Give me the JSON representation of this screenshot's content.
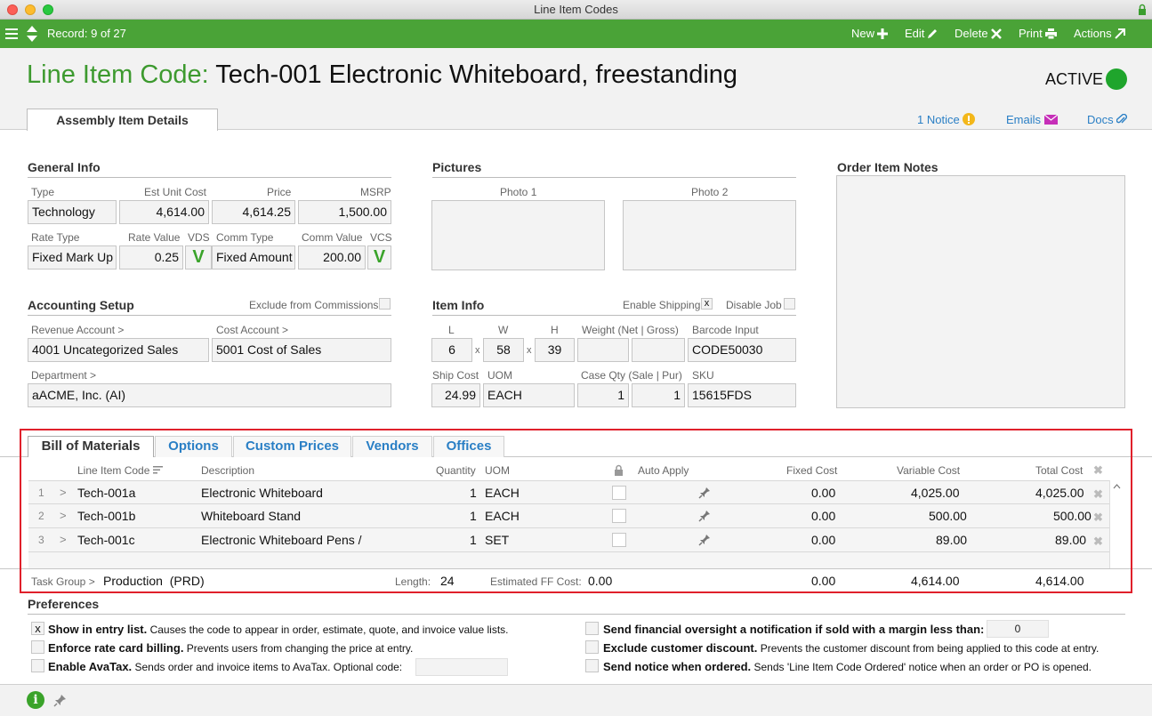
{
  "window": {
    "title": "Line Item Codes"
  },
  "toolbar": {
    "record": "Record: 9 of 27",
    "new_label": "New",
    "edit_label": "Edit",
    "delete_label": "Delete",
    "print_label": "Print",
    "actions_label": "Actions"
  },
  "header": {
    "title_label": "Line Item Code:",
    "title_value": "Tech-001 Electronic Whiteboard, freestanding",
    "status": "ACTIVE",
    "tab": "Assembly Item Details",
    "notice": "1 Notice",
    "emails": "Emails",
    "docs": "Docs",
    "colors": {
      "brand_green": "#4aa337",
      "status_green": "#1fa52c",
      "link_blue": "#2a7fc5",
      "highlight_red": "#e0202b"
    }
  },
  "general": {
    "heading": "General Info",
    "type_label": "Type",
    "type": "Technology",
    "est_unit_cost_label": "Est Unit Cost",
    "est_unit_cost": "4,614.00",
    "price_label": "Price",
    "price": "4,614.25",
    "msrp_label": "MSRP",
    "msrp": "1,500.00",
    "rate_type_label": "Rate Type",
    "rate_type": "Fixed Mark Up",
    "rate_value_label": "Rate Value",
    "rate_value": "0.25",
    "vds_label": "VDS",
    "vds": "V",
    "comm_type_label": "Comm Type",
    "comm_type": "Fixed Amount",
    "comm_value_label": "Comm Value",
    "comm_value": "200.00",
    "vcs_label": "VCS",
    "vcs": "V"
  },
  "pictures": {
    "heading": "Pictures",
    "photo1": "Photo 1",
    "photo2": "Photo 2"
  },
  "notes": {
    "heading": "Order Item Notes"
  },
  "accounting": {
    "heading": "Accounting Setup",
    "exclude_label": "Exclude from Commissions",
    "revenue_label": "Revenue Account >",
    "revenue": "4001 Uncategorized Sales",
    "cost_label": "Cost Account >",
    "cost": "5001 Cost of Sales",
    "department_label": "Department >",
    "department": "aACME, Inc. (AI)"
  },
  "item_info": {
    "heading": "Item Info",
    "enable_shipping_label": "Enable Shipping",
    "enable_shipping_mark": "x",
    "disable_job_label": "Disable Job",
    "l_label": "L",
    "l": "6",
    "w_label": "W",
    "w": "58",
    "h_label": "H",
    "h": "39",
    "x_sep": "x",
    "weight_label": "Weight (Net | Gross)",
    "barcode_label": "Barcode Input",
    "barcode": "CODE50030",
    "ship_cost_label": "Ship Cost",
    "ship_cost": "24.99",
    "uom_label": "UOM",
    "uom": "EACH",
    "case_qty_label": "Case Qty (Sale | Pur)",
    "case_qty_sale": "1",
    "case_qty_pur": "1",
    "sku_label": "SKU",
    "sku": "15615FDS"
  },
  "bom": {
    "tabs": [
      "Bill of Materials",
      "Options",
      "Custom Prices",
      "Vendors",
      "Offices"
    ],
    "headers": {
      "code": "Line Item Code",
      "description": "Description",
      "quantity": "Quantity",
      "uom": "UOM",
      "auto_apply": "Auto Apply",
      "fixed_cost": "Fixed Cost",
      "variable_cost": "Variable Cost",
      "total_cost": "Total Cost"
    },
    "rows": [
      {
        "num": "1",
        "code": "Tech-001a",
        "description": "Electronic Whiteboard",
        "quantity": "1",
        "uom": "EACH",
        "fixed": "0.00",
        "variable": "4,025.00",
        "total": "4,025.00"
      },
      {
        "num": "2",
        "code": "Tech-001b",
        "description": "Whiteboard Stand",
        "quantity": "1",
        "uom": "EACH",
        "fixed": "0.00",
        "variable": "500.00",
        "total": "500.00"
      },
      {
        "num": "3",
        "code": "Tech-001c",
        "description": "Electronic Whiteboard Pens /",
        "quantity": "1",
        "uom": "SET",
        "fixed": "0.00",
        "variable": "89.00",
        "total": "89.00"
      }
    ],
    "footer": {
      "task_group_label": "Task Group >",
      "task_group": "Production",
      "task_group_code": "(PRD)",
      "length_label": "Length:",
      "length": "24",
      "ff_label": "Estimated FF Cost:",
      "ff": "0.00",
      "fixed_total": "0.00",
      "variable_total": "4,614.00",
      "total": "4,614.00"
    },
    "expand_glyph": ">"
  },
  "preferences": {
    "heading": "Preferences",
    "show_entry_bold": "Show in entry list.",
    "show_entry_text": " Causes the code to appear in order, estimate, quote, and invoice value lists.",
    "show_entry_mark": "x",
    "rate_card_bold": "Enforce rate card billing.",
    "rate_card_text": " Prevents users from changing the price at entry.",
    "avatax_bold": "Enable AvaTax.",
    "avatax_text": " Sends order and invoice items to AvaTax. Optional code:",
    "oversight_bold": "Send financial oversight a notification if sold with a margin less than:",
    "oversight_value": "0",
    "exclude_disc_bold": "Exclude customer discount.",
    "exclude_disc_text": " Prevents the customer discount from being applied to this code at entry.",
    "notice_bold": "Send notice when ordered.",
    "notice_text": " Sends 'Line Item Code Ordered' notice when an order or PO is opened."
  },
  "bottom": {
    "info_glyph": "i"
  }
}
